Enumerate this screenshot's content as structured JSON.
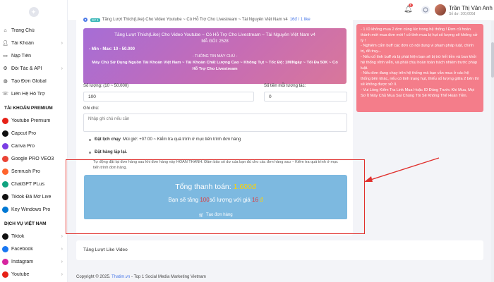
{
  "sidebar": {
    "items": [
      {
        "label": "Trang Chủ",
        "icon": "house-icon",
        "chev": false
      },
      {
        "label": "Tài Khoản",
        "icon": "user-icon",
        "chev": true
      },
      {
        "label": "Nạp Tiền",
        "icon": "card-icon",
        "chev": false
      },
      {
        "label": "Đối Tác & API",
        "icon": "api-icon",
        "chev": true
      },
      {
        "label": "Tạo Đơn Global",
        "icon": "globe-icon",
        "chev": false
      },
      {
        "label": "Liên Hệ Hỗ Trợ",
        "icon": "support-icon",
        "chev": false
      }
    ],
    "premium_heading": "TÀI KHOẢN PREMIUM",
    "premium": [
      {
        "label": "Youtube Premium",
        "color": "#e62117"
      },
      {
        "label": "Capcut Pro",
        "color": "#111111"
      },
      {
        "label": "Canva Pro",
        "color": "#7b3fe4"
      },
      {
        "label": "Google PRO VEO3",
        "color": "#ea4335"
      },
      {
        "label": "Semrush Pro",
        "color": "#ff642d"
      },
      {
        "label": "ChatGPT PLus",
        "color": "#10a37f"
      },
      {
        "label": "Tiktok Đã Mở Live",
        "color": "#111111"
      },
      {
        "label": "Key Windows Pro",
        "color": "#0078d4"
      }
    ],
    "services_heading": "DỊCH VỤ VIỆT NAM",
    "services": [
      {
        "label": "Tiktok",
        "color": "#111111"
      },
      {
        "label": "Facebook",
        "color": "#1877f2"
      },
      {
        "label": "Instagram",
        "color": "#d6249f"
      },
      {
        "label": "Youtube",
        "color": "#e62117"
      }
    ]
  },
  "topbar": {
    "notify_count": "1",
    "user_name": "Trần Thị Vân Anh",
    "balance": "Số dư: 100,000đ"
  },
  "form": {
    "server_badge": "SV 1",
    "server_label": "Tăng Lượt Thích(Like) Cho Video Youtube ~ Có Hỗ Trợ Cho Livestream ~ Tài Nguyên Việt Nam v4",
    "server_price": "16đ / 1 like",
    "desc": {
      "title": "Tăng Lượt Thích(Like) Cho Video Youtube ~ Có Hỗ Trợ Cho Livestream ~ Tài Nguyên Việt Nam v4",
      "code": "MÃ GÓI: 2528",
      "minmax": "- Min - Max: 10 - 50.000",
      "info_title": "- THÔNG TIN MÁY CHỦ -",
      "info": "Máy Chủ Sử Dụng Nguồn Tài Khoản Việt Nam ~ Tài Khoản Chất Lượng Cao ~ Không Tụt ~ Tốc Độ: 1M/Ngày ~ Tối Đa 50K ~ Có Hỗ Trợ Cho Livestream"
    },
    "qty_label": "Số lượng: (10 ~ 50.000)",
    "qty_value": "100",
    "time_label": "Số tiền mỗi tương tác:",
    "time_value": "0",
    "note_label": "Ghi chú:",
    "note_placeholder": "Nhập ghi chú nếu cần",
    "schedule_title": "Đặt lịch chạy",
    "schedule_text": "Múi giờ: +07:00 ~ Kiểm tra quá trình ở mục tiến trình đơn hàng",
    "repeat_title": "Đặt hàng lặp lại.",
    "repeat_text": "Tự động đặt lại đơn hàng sau khi đơn hàng này HOÀN THÀNH. Đảm bảo số dư của bạn đủ cho các đơn hàng sau ~ Kiểm tra quá trình ở mục tiến trình đơn hàng.",
    "total_label": "Tổng thanh toán:",
    "total_value": "1.600đ",
    "sub_prefix": "Bạn sẽ tăng",
    "sub_qty": "100",
    "sub_mid": "số lượng với giá",
    "sub_price": "16",
    "sub_unit": "đ",
    "order_button": "Tạo đơn hàng"
  },
  "info_panel": [
    "- 1 ID không mua 2 đơn cùng lúc trong hệ thống ! Đơn cũ hoàn thành mới mua đơn mới ! cố tình mua bị hụt số lượng sẽ không xử lý !",
    "- Nghiêm cấm buff các đơn có nội dung vi phạm pháp luật, chính trị, đồ trụy...",
    "- Nếu cố tình buff và bị phát hiện bạn sẽ bị trừ hết tiền và ban khỏi hệ thống vĩnh viễn, và phải chịu hoàn toàn trách nhiệm trước pháp luật.",
    "- Nếu đơn đang chạy trên hệ thống mà bạn vẫn mua ở các hệ thống bên khác, nếu có tình trạng hụt, thiếu số lượng giữa 2 bên thì sẽ không được xử lí.",
    "- Vui Lòng Kiểm Tra Link Mua Hoặc ID Đúng Trước Khi Mua, Mọi Sơ Ít Máy Chủ Mua Sai Chúng Tôi Sẽ Không Thể Hoàn Tiền."
  ],
  "bottom_card": "Tăng Lượt Like Video",
  "footer": {
    "prefix": "Copyright © 2025.",
    "brand": "Thatim.vn",
    "suffix": "- Top 1 Social Media Marketing Vietnam"
  },
  "colors": {
    "accent": "#4a79e8",
    "total_box": "#7db9e0",
    "info_panel": "#f47d8a",
    "highlight": "#e0302d"
  }
}
